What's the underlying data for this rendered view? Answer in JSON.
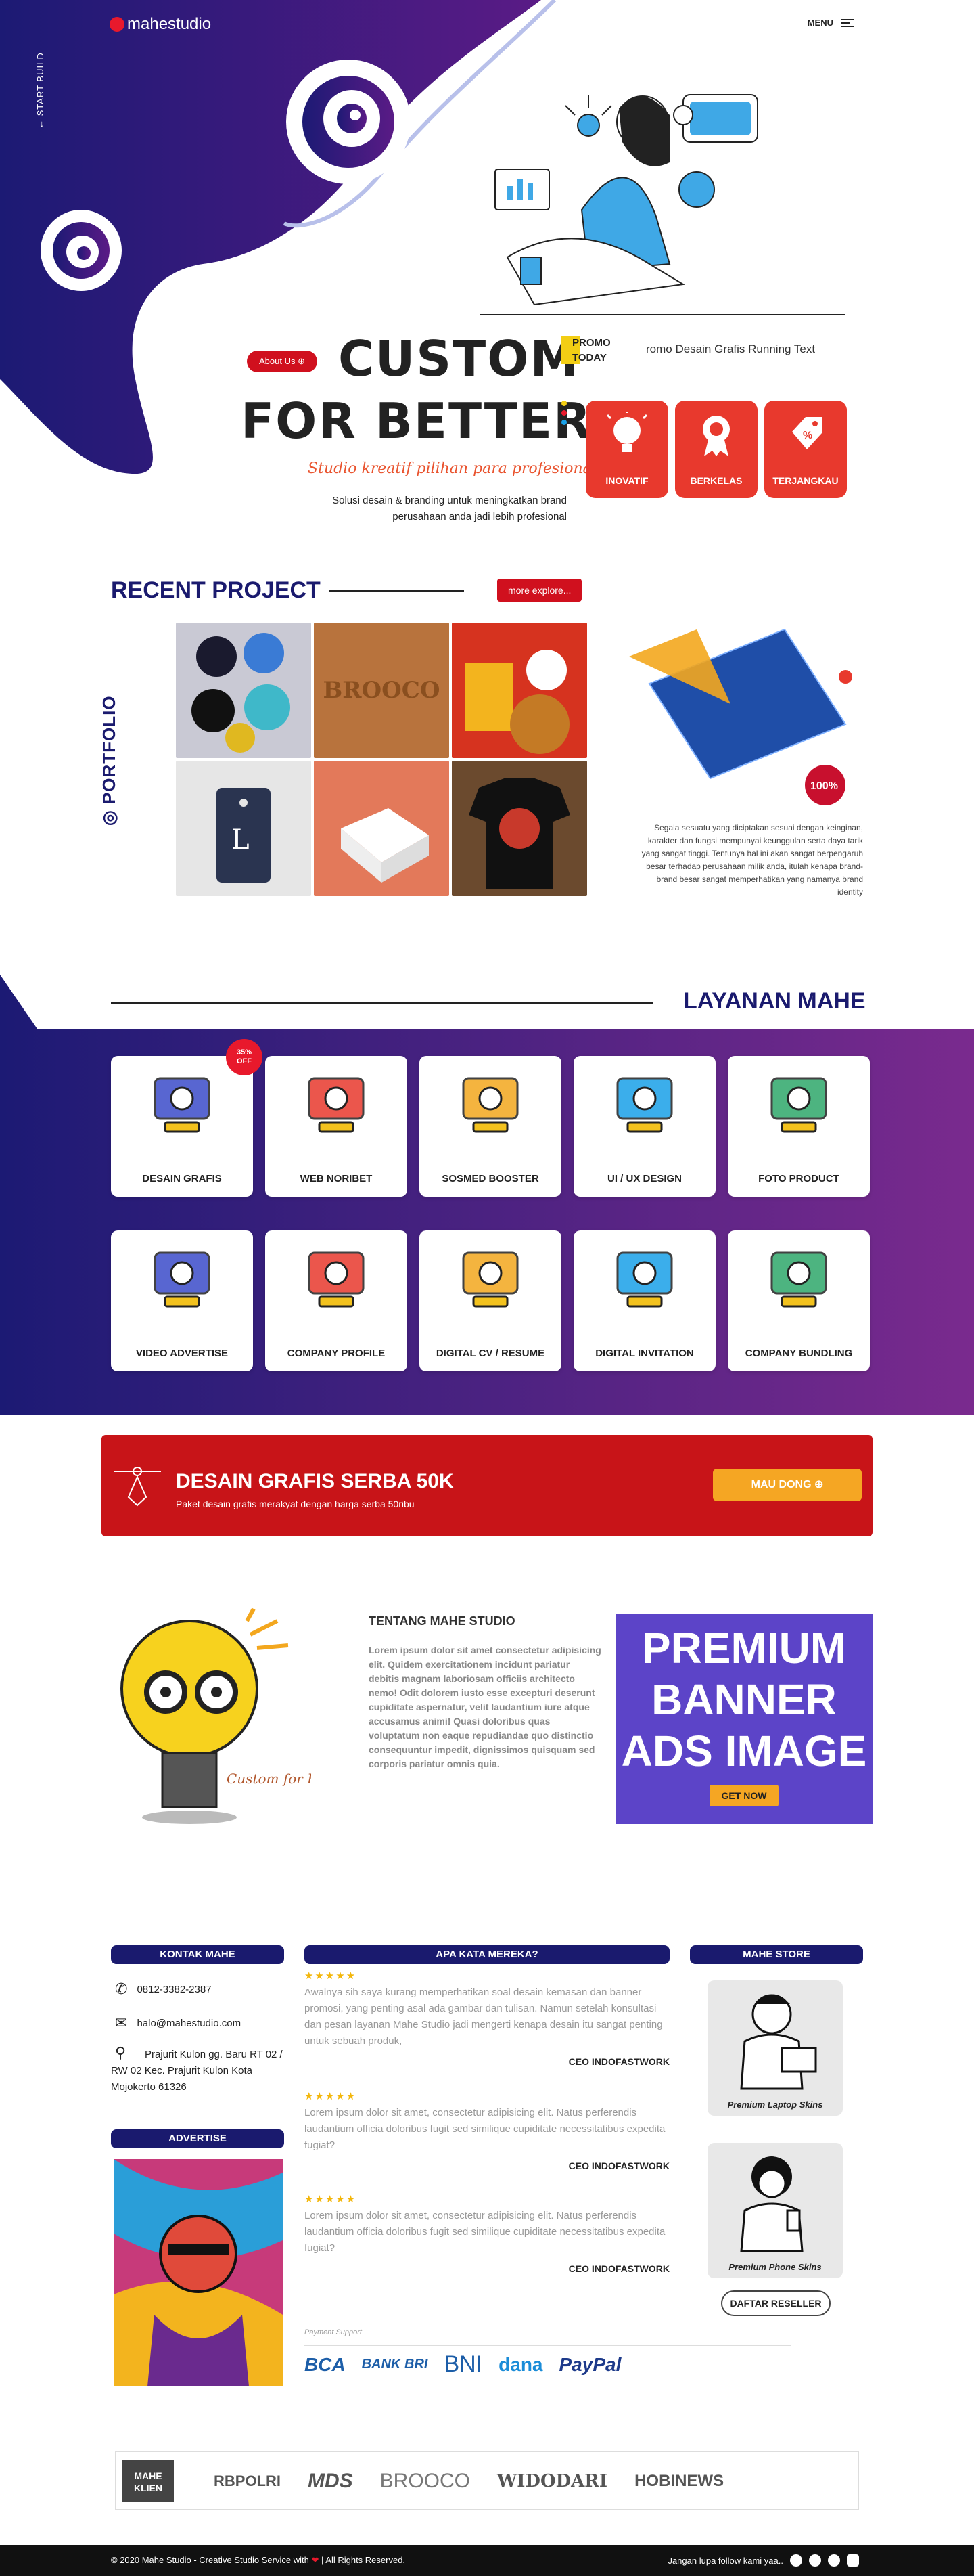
{
  "header": {
    "logo": "mahestudio",
    "menu": "MENU",
    "start_build": "START BUILD"
  },
  "hero": {
    "about_btn": "About Us",
    "line1": "CUSTOM",
    "line2": "FOR BETTER",
    "tagline": "Studio kreatif pilihan para profesional",
    "desc": "Solusi desain & branding untuk meningkatkan brand perusahaan anda jadi lebih profesional",
    "promo_label": "PROMO TODAY",
    "running_text": "romo Desain Grafis Running Text",
    "features": [
      {
        "label": "INOVATIF"
      },
      {
        "label": "BERKELAS"
      },
      {
        "label": "TERJANGKAU"
      }
    ]
  },
  "recent": {
    "title": "RECENT PROJECT",
    "more_btn": "more explore...",
    "side_label": "PORTFOLIO",
    "text": "Segala sesuatu yang diciptakan sesuai dengan keinginan, karakter dan fungsi mempunyai keunggulan serta daya tarik yang sangat tinggi. Tentunya hal ini akan sangat berpengaruh besar terhadap perusahaan milik anda, itulah kenapa brand-brand besar sangat memperhatikan yang namanya brand identity",
    "badge": "100%"
  },
  "layanan": {
    "title": "LAYANAN MAHE",
    "discount": "35%",
    "discount2": "OFF",
    "items": [
      {
        "label": "DESAIN GRAFIS"
      },
      {
        "label": "WEB NORIBET"
      },
      {
        "label": "SOSMED BOOSTER"
      },
      {
        "label": "UI / UX DESIGN"
      },
      {
        "label": "FOTO PRODUCT"
      },
      {
        "label": "VIDEO ADVERTISE"
      },
      {
        "label": "COMPANY PROFILE"
      },
      {
        "label": "DIGITAL CV / RESUME"
      },
      {
        "label": "DIGITAL INVITATION"
      },
      {
        "label": "COMPANY BUNDLING"
      }
    ]
  },
  "promo_band": {
    "title": "DESAIN GRAFIS SERBA 50K",
    "subtitle": "Paket desain grafis merakyat dengan harga serba 50ribu",
    "button": "MAU DONG"
  },
  "about": {
    "mascot_text": "Custom for Better",
    "title": "TENTANG MAHE STUDIO",
    "text": "Lorem ipsum dolor sit amet consectetur adipisicing elit. Quidem exercitationem incidunt pariatur debitis magnam laboriosam officiis architecto nemo! Odit dolorem iusto esse excepturi deserunt cupiditate aspernatur, velit laudantium iure atque accusamus animi! Quasi doloribus quas voluptatum non eaque repudiandae quo distinctio consequuntur impedit, dignissimos quisquam sed corporis pariatur omnis quia.",
    "ad_title": "PREMIUM BANNER ADS IMAGE",
    "ad_button": "GET NOW"
  },
  "contact": {
    "title": "KONTAK MAHE",
    "phone": "0812-3382-2387",
    "email": "halo@mahestudio.com",
    "address": "Prajurit Kulon gg. Baru RT 02 / RW 02 Kec. Prajurit Kulon Kota Mojokerto 61326",
    "advertise": "ADVERTISE"
  },
  "testimonials": {
    "title": "APA KATA MEREKA?",
    "items": [
      {
        "stars": "★★★★★",
        "text": "Awalnya sih saya kurang memperhatikan soal desain kemasan dan banner promosi, yang penting asal ada gambar dan tulisan. Namun setelah konsultasi dan pesan layanan Mahe Studio jadi mengerti kenapa desain itu sangat penting untuk sebuah produk,",
        "who": "CEO INDOFASTWORK"
      },
      {
        "stars": "★★★★★",
        "text": "Lorem ipsum dolor sit amet, consectetur adipisicing elit. Natus perferendis laudantium officia doloribus fugit sed similique cupiditate necessitatibus expedita fugiat?",
        "who": "CEO INDOFASTWORK"
      },
      {
        "stars": "★★★★★",
        "text": "Lorem ipsum dolor sit amet, consectetur adipisicing elit. Natus perferendis laudantium officia doloribus fugit sed similique cupiditate necessitatibus expedita fugiat?",
        "who": "CEO INDOFASTWORK"
      }
    ],
    "payment_label": "Payment Support",
    "payments": [
      "BCA",
      "BANK BRI",
      "BNI",
      "dana",
      "PayPal"
    ]
  },
  "store": {
    "title": "MAHE STORE",
    "item1": "Premium Laptop Skins",
    "item2": "Premium Phone Skins",
    "reseller": "DAFTAR RESELLER"
  },
  "klien": {
    "label": "MAHE KLIEN",
    "logos": [
      "RBPOLRI",
      "MDS",
      "BROOCO",
      "WIDODARI",
      "HOBINEWS"
    ]
  },
  "footer": {
    "left": "© 2020 Mahe Studio - Creative Studio Service with",
    "heart": "❤",
    "left2": "| All Rights Reserved.",
    "right": "Jangan lupa follow kami yaa.."
  }
}
